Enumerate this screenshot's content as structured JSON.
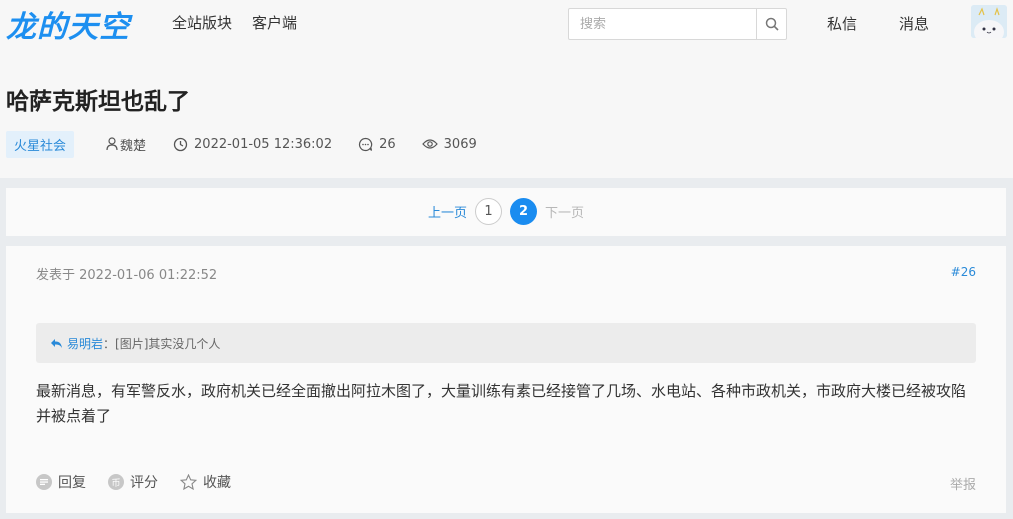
{
  "header": {
    "logo": "龙的天空",
    "nav": [
      "全站版块",
      "客户端"
    ],
    "search_placeholder": "搜索",
    "messages_label": "私信",
    "notifications_label": "消息"
  },
  "thread": {
    "title": "哈萨克斯坦也乱了",
    "category": "火星社会",
    "author": "魏楚",
    "datetime": "2022-01-05 12:36:02",
    "comments": "26",
    "views": "3069"
  },
  "pagination": {
    "prev_label": "上一页",
    "pages": [
      "1",
      "2"
    ],
    "current": "2",
    "next_label": "下一页"
  },
  "post": {
    "posted_label": "发表于 2022-01-06 01:22:52",
    "floor": "#26",
    "quote_user": "易明岩",
    "quote_text": "：[图片]其实没几个人",
    "content": "最新消息，有军警反水，政府机关已经全面撤出阿拉木图了，大量训练有素已经接管了几场、水电站、各种市政机关，市政府大楼已经被攻陷并被点着了",
    "actions": {
      "reply": "回复",
      "rate": "评分",
      "rate_icon_text": "币",
      "favorite": "收藏",
      "report": "举报"
    }
  },
  "colors": {
    "accent": "#1a8cf0",
    "link": "#2a8ad8"
  }
}
